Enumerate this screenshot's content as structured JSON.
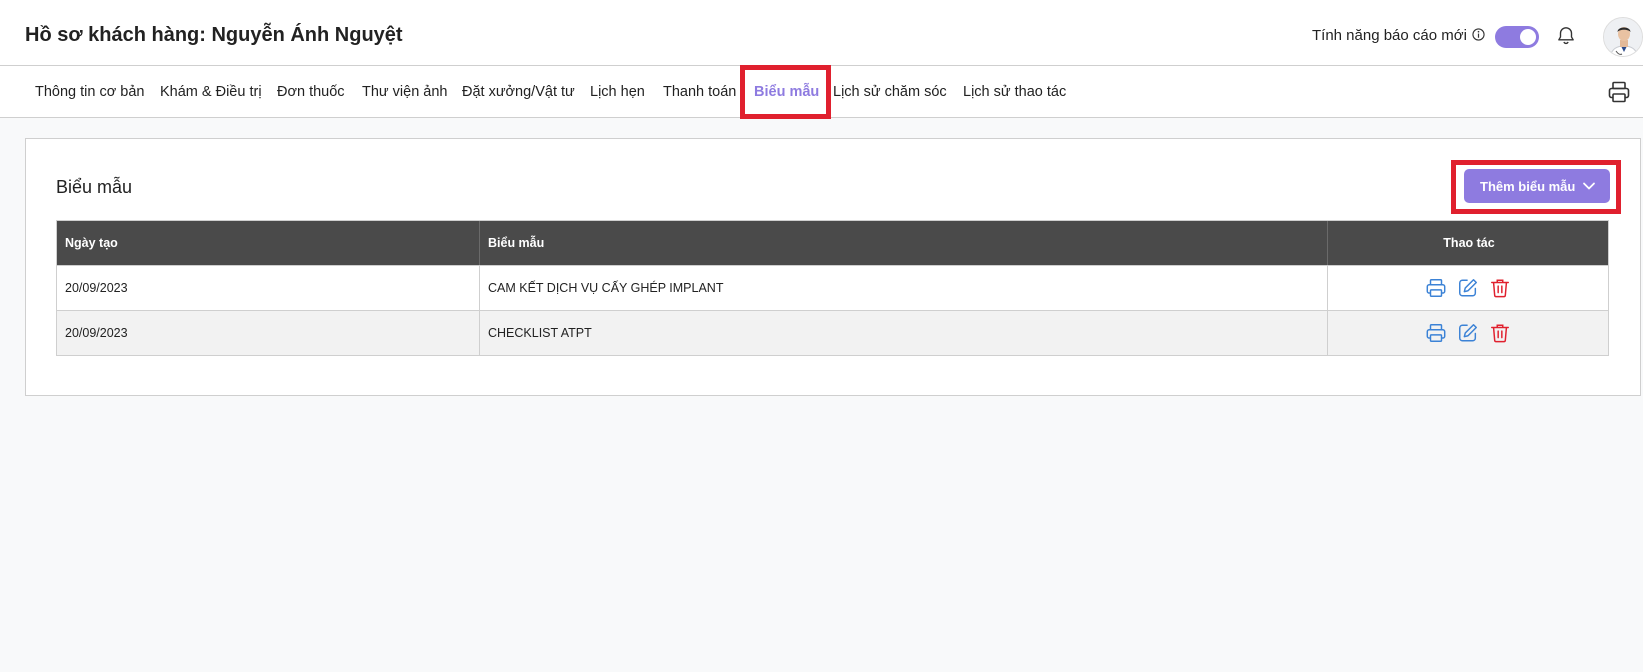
{
  "header": {
    "title": "Hồ sơ khách hàng: Nguyễn Ánh Nguyệt",
    "feature_label": "Tính năng báo cáo mới",
    "toggle_on": true
  },
  "tabs": [
    {
      "label": "Thông tin cơ bản",
      "active": false
    },
    {
      "label": "Khám & Điều trị",
      "active": false
    },
    {
      "label": "Đơn thuốc",
      "active": false
    },
    {
      "label": "Thư viện ảnh",
      "active": false
    },
    {
      "label": "Đặt xưởng/Vật tư",
      "active": false
    },
    {
      "label": "Lịch hẹn",
      "active": false
    },
    {
      "label": "Thanh toán",
      "active": false
    },
    {
      "label": "Biểu mẫu",
      "active": true
    },
    {
      "label": "Lịch sử chăm sóc",
      "active": false
    },
    {
      "label": "Lịch sử thao tác",
      "active": false
    }
  ],
  "section": {
    "title": "Biểu mẫu",
    "add_button_label": "Thêm biểu mẫu"
  },
  "table": {
    "columns": [
      "Ngày tạo",
      "Biểu mẫu",
      "Thao tác"
    ],
    "rows": [
      {
        "date": "20/09/2023",
        "form": "CAM KẾT DỊCH VỤ CẤY GHÉP IMPLANT"
      },
      {
        "date": "20/09/2023",
        "form": "CHECKLIST ATPT"
      }
    ]
  },
  "colors": {
    "accent": "#8e7be0",
    "action_blue": "#3b82d6",
    "delete_red": "#e0202e",
    "header_dark": "#4a4a4a",
    "highlight": "#e0202e"
  },
  "icons": [
    "info-icon",
    "bell-icon",
    "avatar",
    "print-icon",
    "edit-icon",
    "trash-icon",
    "chevron-down-icon"
  ]
}
